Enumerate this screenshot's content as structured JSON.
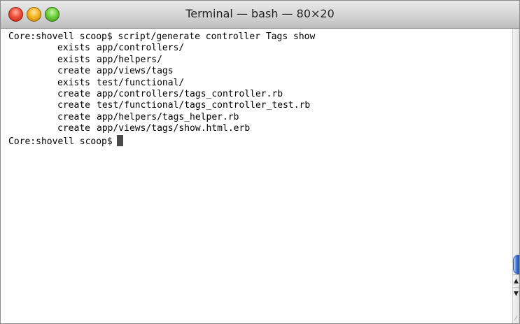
{
  "window": {
    "title": "Terminal — bash — 80×20"
  },
  "terminal": {
    "prompt": "Core:shovell scoop$",
    "command": "script/generate controller Tags show",
    "output": [
      {
        "verb": "exists",
        "path": "app/controllers/"
      },
      {
        "verb": "exists",
        "path": "app/helpers/"
      },
      {
        "verb": "create",
        "path": "app/views/tags"
      },
      {
        "verb": "exists",
        "path": "test/functional/"
      },
      {
        "verb": "create",
        "path": "app/controllers/tags_controller.rb"
      },
      {
        "verb": "create",
        "path": "test/functional/tags_controller_test.rb"
      },
      {
        "verb": "create",
        "path": "app/helpers/tags_helper.rb"
      },
      {
        "verb": "create",
        "path": "app/views/tags/show.html.erb"
      }
    ]
  },
  "scrollbar": {
    "up_arrow": "▲",
    "down_arrow": "▼"
  },
  "icons": {
    "close": "close-button",
    "minimize": "minimize-button",
    "zoom": "zoom-button",
    "resize": "resize-grip-icon"
  }
}
